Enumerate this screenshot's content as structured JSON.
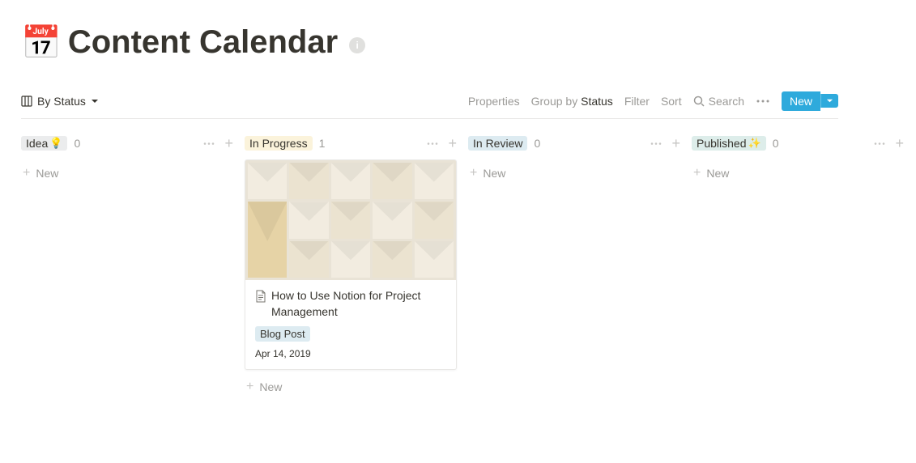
{
  "page": {
    "emoji": "📅",
    "title": "Content Calendar"
  },
  "toolbar": {
    "view_name": "By Status",
    "properties_label": "Properties",
    "group_by_prefix": "Group by ",
    "group_by_value": "Status",
    "filter_label": "Filter",
    "sort_label": "Sort",
    "search_label": "Search",
    "new_label": "New"
  },
  "columns": [
    {
      "tag_class": "tag-idea",
      "label": "Idea",
      "emoji": "💡",
      "count": "0",
      "cards": []
    },
    {
      "tag_class": "tag-progress",
      "label": "In Progress",
      "emoji": "",
      "count": "1",
      "cards": [
        {
          "title": "How to Use Notion for Project Management",
          "tag": "Blog Post",
          "date": "Apr 14, 2019"
        }
      ]
    },
    {
      "tag_class": "tag-review",
      "label": "In Review",
      "emoji": "",
      "count": "0",
      "cards": []
    },
    {
      "tag_class": "tag-published",
      "label": "Published",
      "emoji": "✨",
      "count": "0",
      "cards": []
    }
  ],
  "labels": {
    "new_item": "New"
  }
}
